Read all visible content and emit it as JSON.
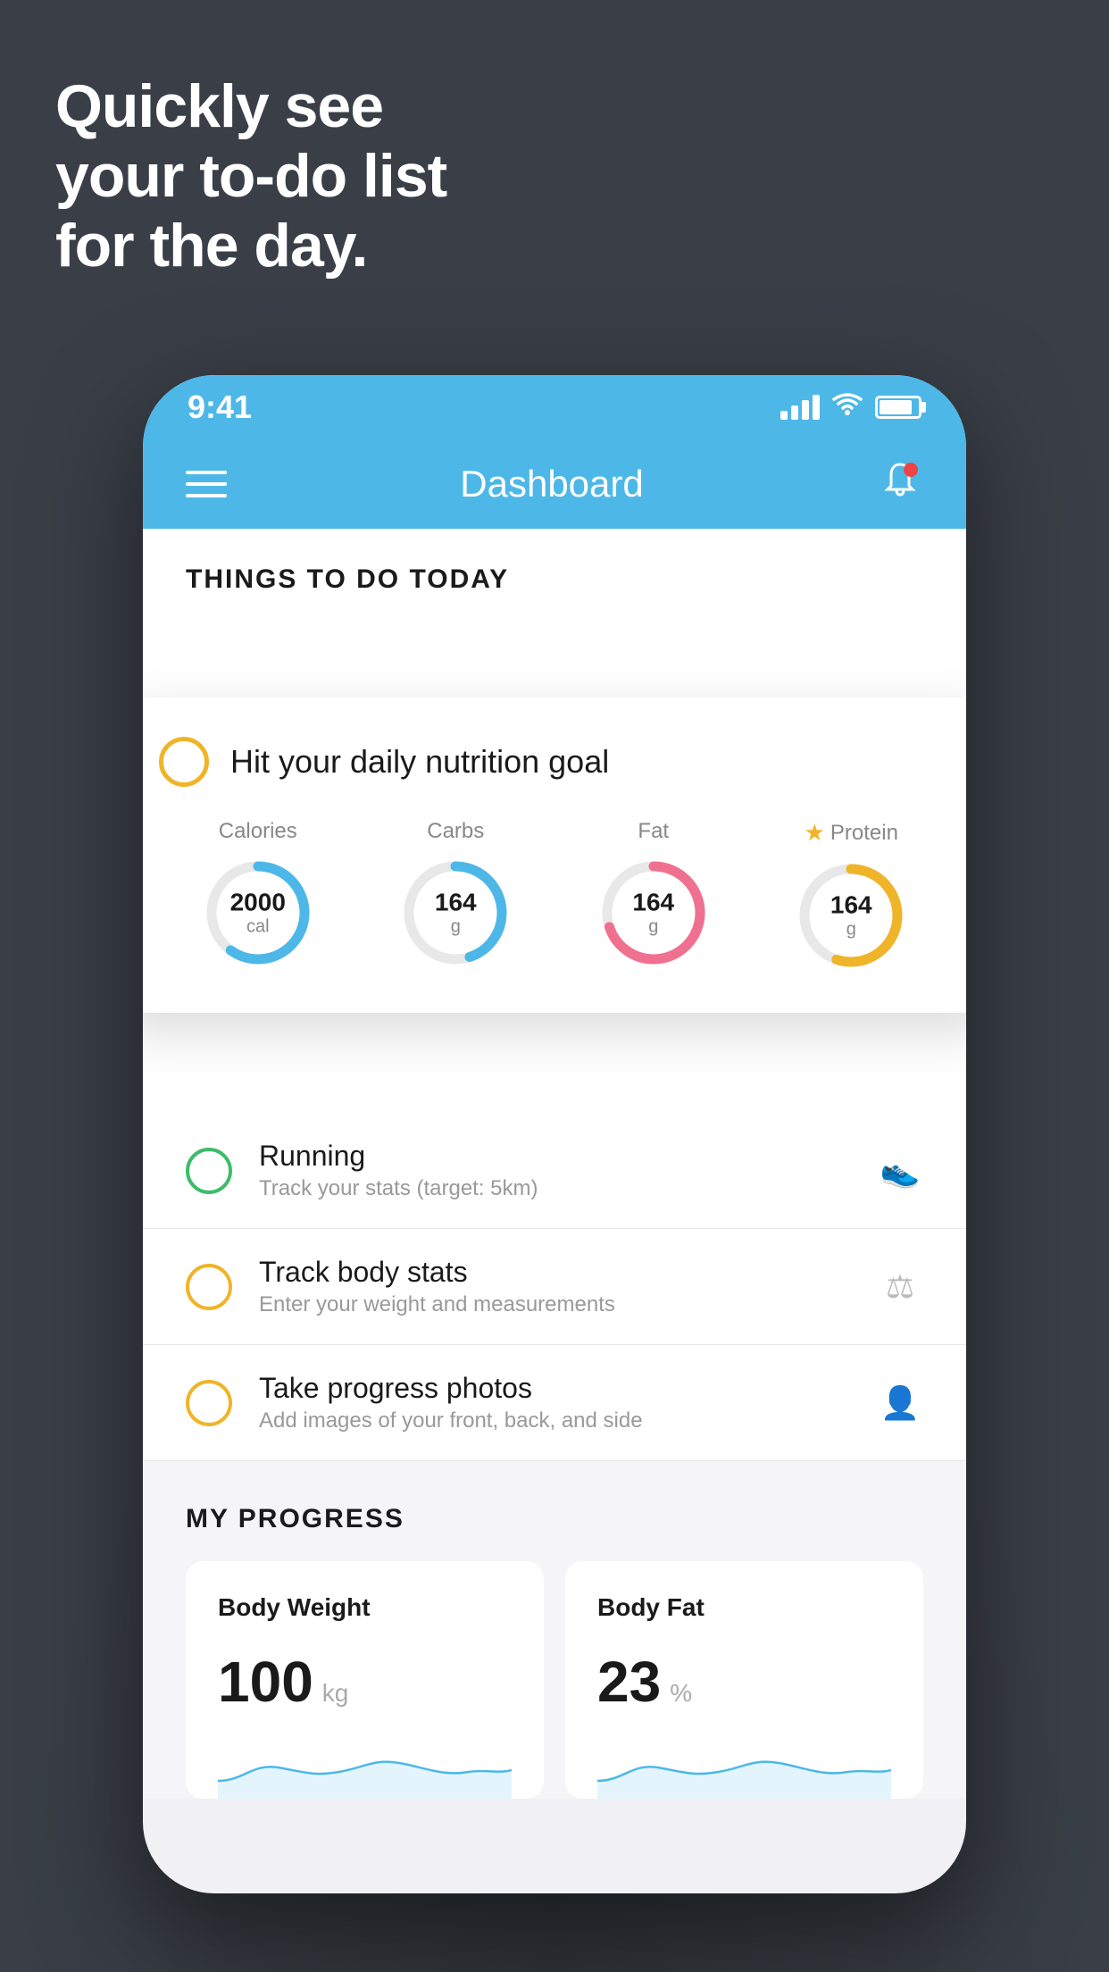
{
  "hero": {
    "line1": "Quickly see",
    "line2": "your to-do list",
    "line3": "for the day."
  },
  "status_bar": {
    "time": "9:41"
  },
  "nav": {
    "title": "Dashboard"
  },
  "things_section": {
    "heading": "THINGS TO DO TODAY"
  },
  "popup": {
    "title": "Hit your daily nutrition goal",
    "nutrients": [
      {
        "label": "Calories",
        "value": "2000",
        "unit": "cal",
        "color": "#4db8e8",
        "track_color": "#e0e0e0",
        "percent": 60,
        "star": false
      },
      {
        "label": "Carbs",
        "value": "164",
        "unit": "g",
        "color": "#4db8e8",
        "track_color": "#e0e0e0",
        "percent": 45,
        "star": false
      },
      {
        "label": "Fat",
        "value": "164",
        "unit": "g",
        "color": "#f07090",
        "track_color": "#e0e0e0",
        "percent": 70,
        "star": false
      },
      {
        "label": "Protein",
        "value": "164",
        "unit": "g",
        "color": "#f0b429",
        "track_color": "#e0e0e0",
        "percent": 55,
        "star": true
      }
    ]
  },
  "todo_items": [
    {
      "title": "Running",
      "subtitle": "Track your stats (target: 5km)",
      "circle_color": "green",
      "icon": "👟"
    },
    {
      "title": "Track body stats",
      "subtitle": "Enter your weight and measurements",
      "circle_color": "yellow",
      "icon": "⚖"
    },
    {
      "title": "Take progress photos",
      "subtitle": "Add images of your front, back, and side",
      "circle_color": "yellow",
      "icon": "👤"
    }
  ],
  "progress": {
    "heading": "MY PROGRESS",
    "cards": [
      {
        "title": "Body Weight",
        "value": "100",
        "unit": "kg"
      },
      {
        "title": "Body Fat",
        "value": "23",
        "unit": "%"
      }
    ]
  }
}
